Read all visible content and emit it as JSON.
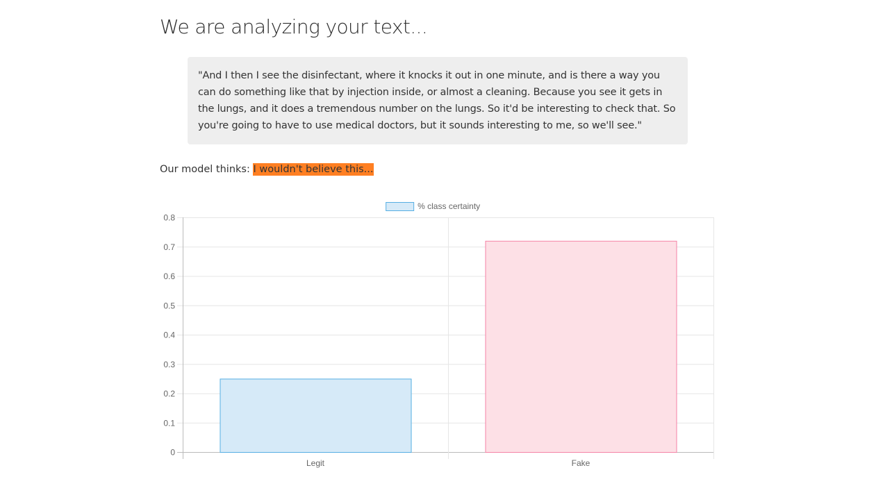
{
  "page": {
    "title": "We are analyzing your text...",
    "quote": "\"And I then I see the disinfectant, where it knocks it out in one minute, and is there a way you can do something like that by injection inside, or almost a cleaning. Because you see it gets in the lungs, and it does a tremendous number on the lungs. So it'd be interesting to check that. So you're going to have to use medical doctors, but it sounds interesting to me, so we'll see.\"",
    "verdict_prefix": "Our model thinks:",
    "verdict_label": "I wouldn't believe this...",
    "verdict_color": "#ff7f22"
  },
  "chart_data": {
    "type": "bar",
    "categories": [
      "Legit",
      "Fake"
    ],
    "series": [
      {
        "name": "% class certainty",
        "values": [
          0.25,
          0.72
        ],
        "fill_colors": [
          "#d6eaf8",
          "#fde0e6"
        ],
        "border_colors": [
          "#55aee3",
          "#f483a6"
        ]
      }
    ],
    "ylim": [
      0,
      0.8
    ],
    "yticks": [
      "0",
      "0.1",
      "0.2",
      "0.3",
      "0.4",
      "0.5",
      "0.6",
      "0.7",
      "0.8"
    ],
    "legend_position": "top",
    "grid": true
  }
}
